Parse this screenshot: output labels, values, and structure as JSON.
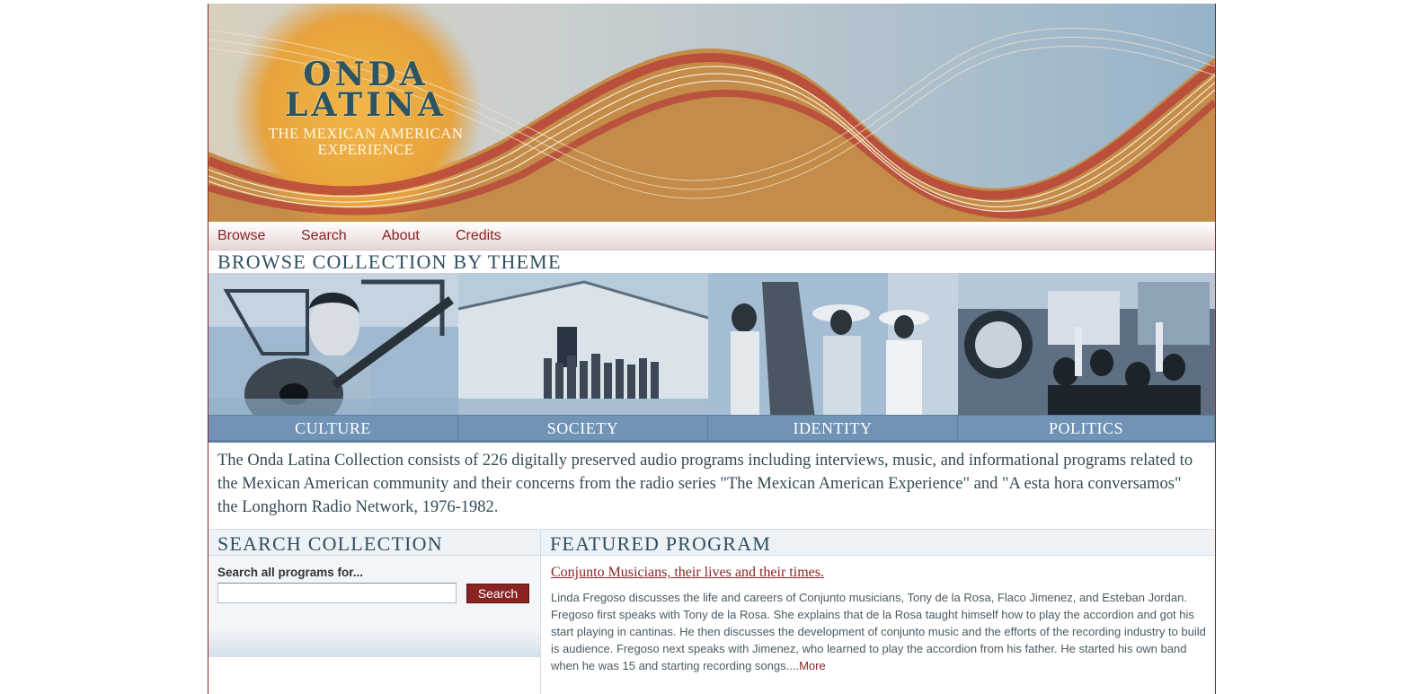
{
  "banner": {
    "logo_line1": "ONDA",
    "logo_line2": "LATINA",
    "logo_subtitle_1": "THE MEXICAN AMERICAN",
    "logo_subtitle_2": "EXPERIENCE"
  },
  "nav": {
    "items": [
      {
        "label": "Browse"
      },
      {
        "label": "Search"
      },
      {
        "label": "About"
      },
      {
        "label": "Credits"
      }
    ]
  },
  "browse": {
    "heading": "BROWSE COLLECTION BY THEME",
    "themes": [
      {
        "label": "CULTURE"
      },
      {
        "label": "SOCIETY"
      },
      {
        "label": "IDENTITY"
      },
      {
        "label": "POLITICS"
      }
    ]
  },
  "description": "The Onda Latina Collection consists of 226 digitally preserved audio programs including interviews, music, and informational programs related to the Mexican American community and their concerns from the radio series \"The Mexican American Experience\" and \"A esta hora conversamos\" the Longhorn Radio Network, 1976-1982.",
  "search": {
    "heading": "SEARCH COLLECTION",
    "label": "Search all programs for...",
    "input_value": "",
    "button_label": "Search"
  },
  "featured": {
    "heading": "FEATURED PROGRAM",
    "title": "Conjunto Musicians, their lives and their times.",
    "description": "Linda Fregoso discusses the life and careers of Conjunto musicians, Tony de la Rosa, Flaco Jimenez, and Esteban Jordan. Fregoso first speaks with Tony de la Rosa. She explains that de la Rosa taught himself how to play the accordion and got his start playing in cantinas. He then discusses the development of conjunto music and the efforts of the recording industry to build is audience. Fregoso next speaks with Jimenez, who learned to play the accordion from his father. He started his own band when he was 15 and starting recording songs....",
    "more_label": "More"
  },
  "colors": {
    "brand_red": "#8a2323",
    "theme_bar": "#7093b6",
    "heading_text": "#2f4f60",
    "banner_orange": "#c48c48",
    "banner_sky": "#9db4c8"
  }
}
